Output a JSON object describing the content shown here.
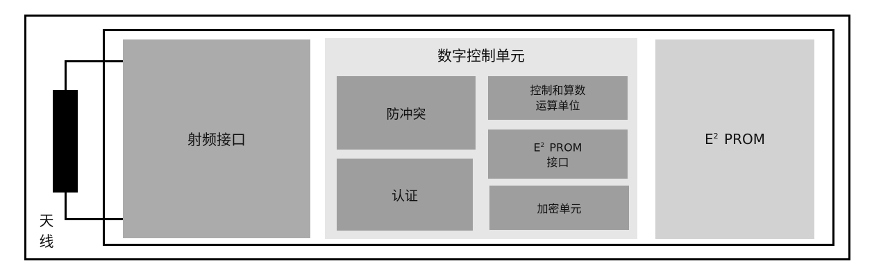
{
  "rf_interface": {
    "label": "射频接口"
  },
  "digital_control_unit": {
    "title": "数字控制单元",
    "anticollision": "防冲突",
    "authentication": "认证",
    "control_alu": {
      "line1": "控制和算数",
      "line2": "运算单位"
    },
    "eeprom_interface": {
      "e": "E",
      "sup": "2",
      "rest": " PROM",
      "line2": "接口"
    },
    "encryption_unit": "加密单元"
  },
  "eeprom": {
    "e": "E",
    "sup": "2",
    "rest": " PROM"
  },
  "antenna": {
    "line1": "天",
    "line2": "线"
  }
}
